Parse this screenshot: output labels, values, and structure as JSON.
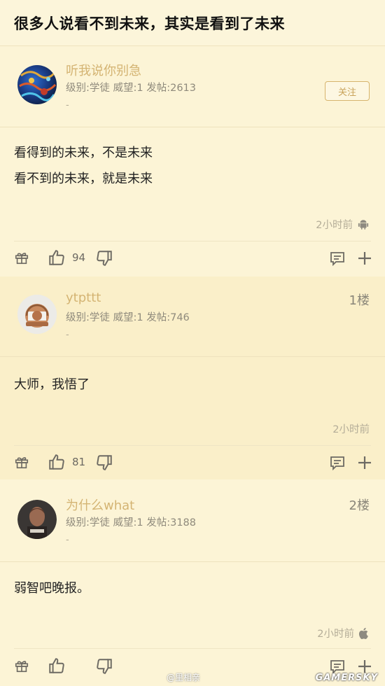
{
  "page": {
    "title": "很多人说看不到未来，其实是看到了未来"
  },
  "posts": [
    {
      "username": "听我说你别急",
      "meta": "级别:学徒 威望:1 发帖:2613",
      "dash": "-",
      "follow_label": "关注",
      "floor": "",
      "content": [
        "看得到的未来，不是未来",
        "看不到的未来，就是未来"
      ],
      "time": "2小时前",
      "device_icon": "android-icon",
      "likes": "94"
    },
    {
      "username": "ytpttt",
      "meta": "级别:学徒 威望:1 发帖:746",
      "dash": "-",
      "floor": "1楼",
      "content": [
        "大师，我悟了"
      ],
      "time": "2小时前",
      "device_icon": "",
      "likes": "81"
    },
    {
      "username": "为什么what",
      "meta": "级别:学徒 威望:1 发帖:3188",
      "dash": "-",
      "floor": "2楼",
      "content": [
        "弱智吧晚报。"
      ],
      "time": "2小时前",
      "device_icon": "apple-icon",
      "likes": ""
    }
  ],
  "overlay": {
    "weibo_watermark": "@里相亲",
    "site_watermark": "GAMERSKY"
  },
  "colors": {
    "background": "#fcf4d6",
    "alt_background": "#faefc9",
    "username": "#d4b473",
    "follow_border": "#d7b46d"
  }
}
